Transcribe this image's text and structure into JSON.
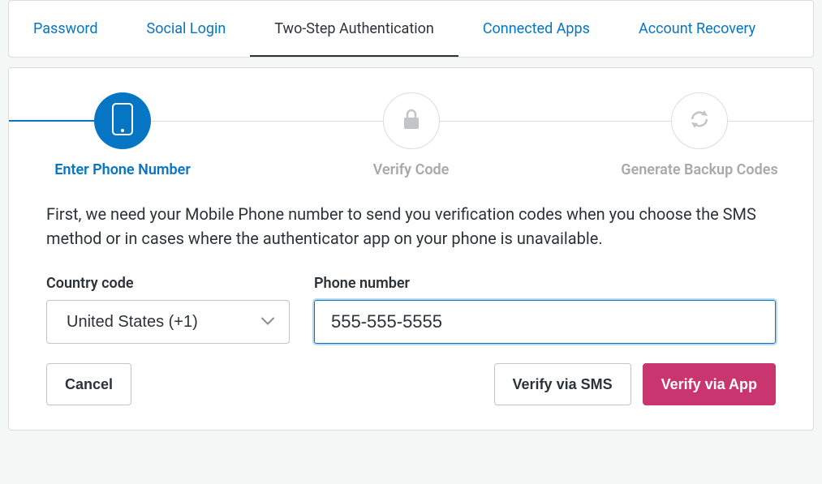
{
  "tabs": [
    {
      "label": "Password",
      "active": false
    },
    {
      "label": "Social Login",
      "active": false
    },
    {
      "label": "Two-Step Authentication",
      "active": true
    },
    {
      "label": "Connected Apps",
      "active": false
    },
    {
      "label": "Account Recovery",
      "active": false
    }
  ],
  "steps": [
    {
      "label": "Enter Phone Number",
      "icon": "phone-icon",
      "active": true
    },
    {
      "label": "Verify Code",
      "icon": "lock-icon",
      "active": false
    },
    {
      "label": "Generate Backup Codes",
      "icon": "refresh-icon",
      "active": false
    }
  ],
  "content": {
    "description": "First, we need your Mobile Phone number to send you verification codes when you choose the SMS method or in cases where the authenticator app on your phone is unavailable.",
    "country_code": {
      "label": "Country code",
      "selected": "United States (+1)"
    },
    "phone": {
      "label": "Phone number",
      "value": "555-555-5555"
    },
    "buttons": {
      "cancel": "Cancel",
      "verify_sms": "Verify via SMS",
      "verify_app": "Verify via App"
    }
  },
  "colors": {
    "accent": "#0675c4",
    "primary_button": "#c9356e"
  }
}
